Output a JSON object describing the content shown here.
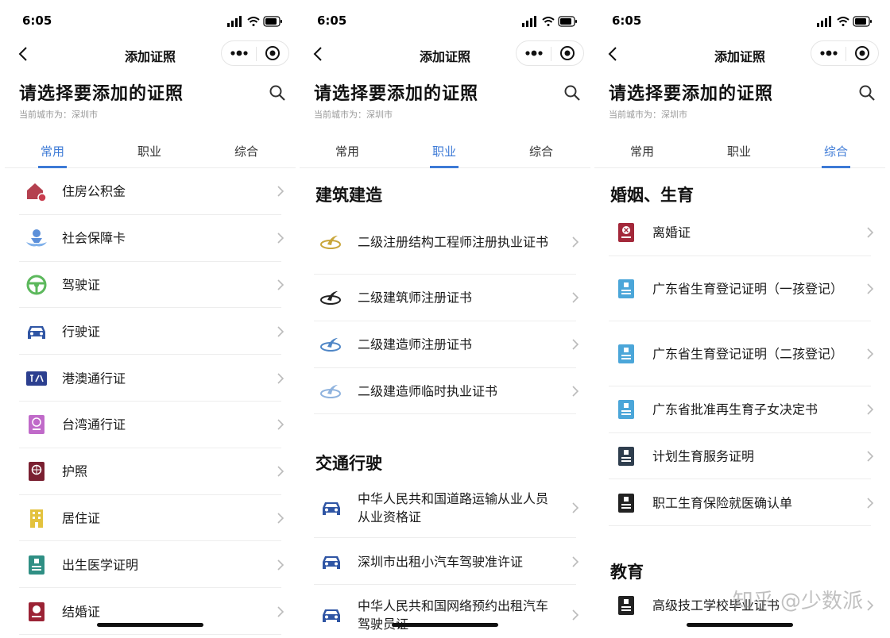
{
  "status_time": "6:05",
  "nav_title": "添加证照",
  "heading": "请选择要添加的证照",
  "city_prefix": "当前城市为：",
  "city": "深圳市",
  "tabs": [
    "常用",
    "职业",
    "综合"
  ],
  "screens": [
    {
      "active_tab": 0,
      "rows": [
        {
          "label": "住房公积金",
          "icon": "house-icon"
        },
        {
          "label": "社会保障卡",
          "icon": "hand-person-icon"
        },
        {
          "label": "驾驶证",
          "icon": "steering-wheel-icon"
        },
        {
          "label": "行驶证",
          "icon": "car-icon"
        },
        {
          "label": "港澳通行证",
          "icon": "hk-macau-permit-icon"
        },
        {
          "label": "台湾通行证",
          "icon": "taiwan-permit-icon"
        },
        {
          "label": "护照",
          "icon": "passport-icon"
        },
        {
          "label": "居住证",
          "icon": "building-icon"
        },
        {
          "label": "出生医学证明",
          "icon": "certificate-icon"
        },
        {
          "label": "结婚证",
          "icon": "marriage-certificate-icon"
        }
      ]
    },
    {
      "active_tab": 1,
      "sections": [
        {
          "title": "建筑建造",
          "rows": [
            {
              "label": "二级注册结构工程师注册执业证书",
              "icon": "construction-logo-gold-icon"
            },
            {
              "label": "二级建筑师注册证书",
              "icon": "construction-logo-dark-icon"
            },
            {
              "label": "二级建造师注册证书",
              "icon": "construction-logo-blue-icon"
            },
            {
              "label": "二级建造师临时执业证书",
              "icon": "construction-logo-lightblue-icon"
            }
          ]
        },
        {
          "title": "交通行驶",
          "rows": [
            {
              "label": "中华人民共和国道路运输从业人员从业资格证",
              "icon": "car-icon"
            },
            {
              "label": "深圳市出租小汽车驾驶准许证",
              "icon": "car-icon"
            },
            {
              "label": "中华人民共和国网络预约出租汽车驾驶员证",
              "icon": "car-icon"
            }
          ]
        }
      ]
    },
    {
      "active_tab": 2,
      "sections": [
        {
          "title": "婚姻、生育",
          "rows": [
            {
              "label": "离婚证",
              "icon": "divorce-certificate-icon"
            },
            {
              "label": "广东省生育登记证明（一孩登记）",
              "icon": "id-card-blue-icon"
            },
            {
              "label": "广东省生育登记证明（二孩登记）",
              "icon": "id-card-blue-icon"
            },
            {
              "label": "广东省批准再生育子女决定书",
              "icon": "id-card-blue-icon"
            },
            {
              "label": "计划生育服务证明",
              "icon": "id-card-dark-icon"
            },
            {
              "label": "职工生育保险就医确认单",
              "icon": "id-card-dark-icon"
            }
          ]
        },
        {
          "title": "教育",
          "rows": [
            {
              "label": "高级技工学校毕业证书",
              "icon": "id-card-dark-icon"
            }
          ]
        }
      ]
    }
  ],
  "watermark": "知乎 @少数派"
}
